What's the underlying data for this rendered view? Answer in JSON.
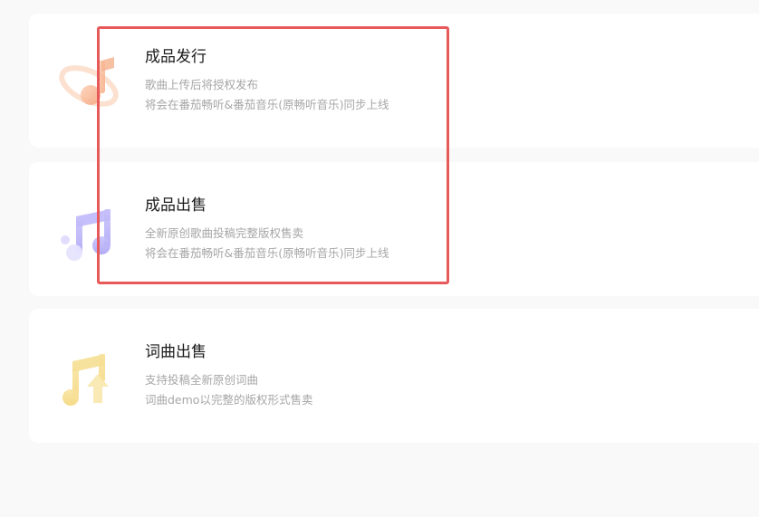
{
  "cards": [
    {
      "title": "成品发行",
      "desc1": "歌曲上传后将授权发布",
      "desc2": "将会在番茄畅听&番茄音乐(原畅听音乐)同步上线",
      "icon": "music-note-ring-icon",
      "color": "#f6a77e"
    },
    {
      "title": "成品出售",
      "desc1": "全新原创歌曲投稿完整版权售卖",
      "desc2": "将会在番茄畅听&番茄音乐(原畅听音乐)同步上线",
      "icon": "music-notes-icon",
      "color": "#a9a2f5"
    },
    {
      "title": "词曲出售",
      "desc1": "支持投稿全新原创词曲",
      "desc2": "词曲demo以完整的版权形式售卖",
      "icon": "music-note-upload-icon",
      "color": "#f5d77a"
    }
  ],
  "highlight_color": "#e85a5a"
}
